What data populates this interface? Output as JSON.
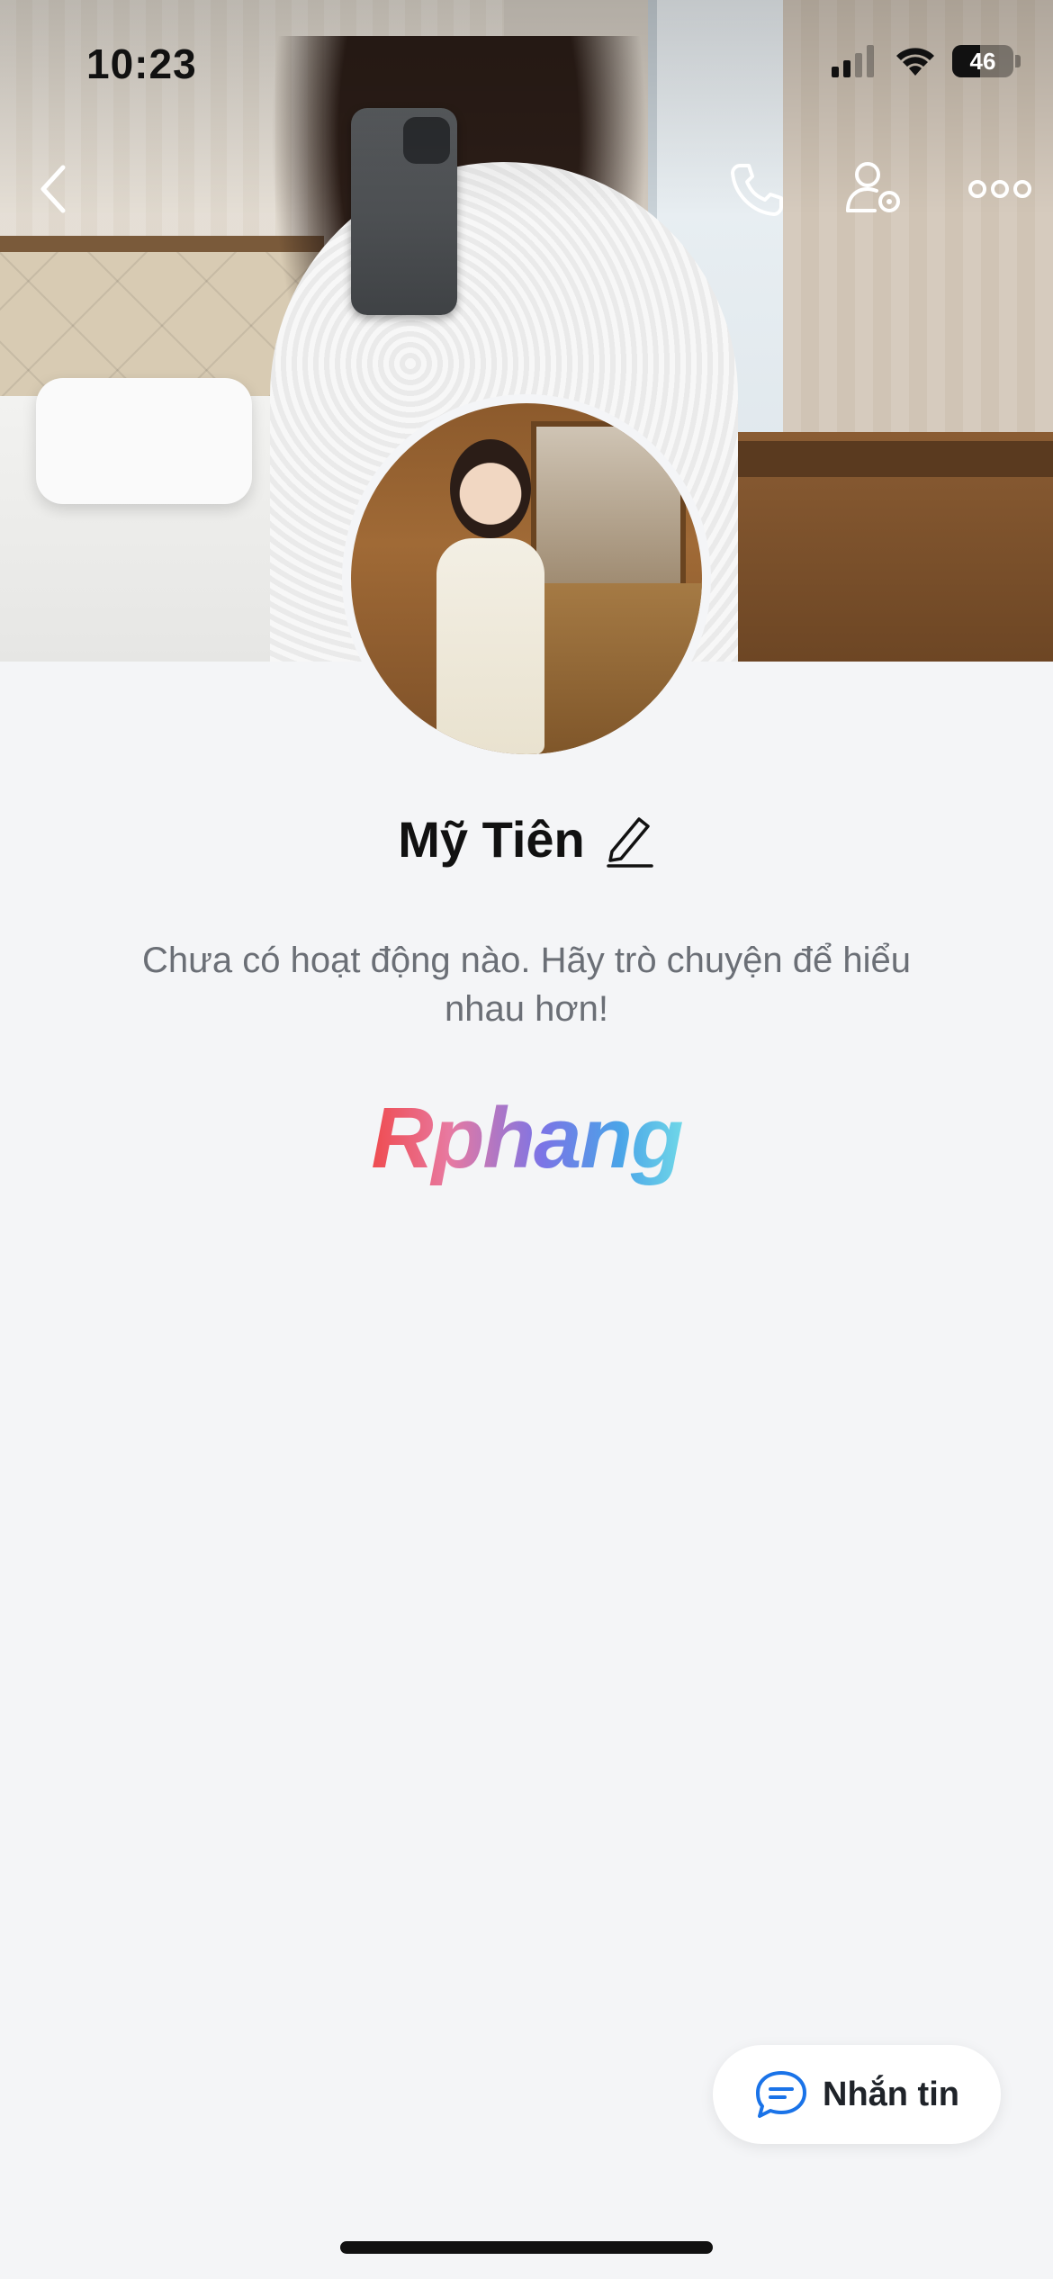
{
  "status_bar": {
    "time": "10:23",
    "battery_level": "46",
    "icons": [
      "cellular-signal-icon",
      "wifi-icon",
      "battery-icon"
    ]
  },
  "header": {
    "icons": [
      "back-icon",
      "phone-icon",
      "user-settings-icon",
      "more-icon"
    ]
  },
  "profile": {
    "name": "Mỹ Tiên",
    "edit_icon": "pencil-icon",
    "activity_text": "Chưa có hoạt động nào. Hãy trò chuyện để hiểu nhau hơn!"
  },
  "watermark": {
    "text": "Rphang"
  },
  "message_button": {
    "label": "Nhắn tin",
    "icon": "chat-bubble-icon"
  },
  "colors": {
    "background": "#f4f5f7",
    "accent_blue": "#1a73e8",
    "text_primary": "#111111",
    "text_secondary": "#6b6f76"
  }
}
